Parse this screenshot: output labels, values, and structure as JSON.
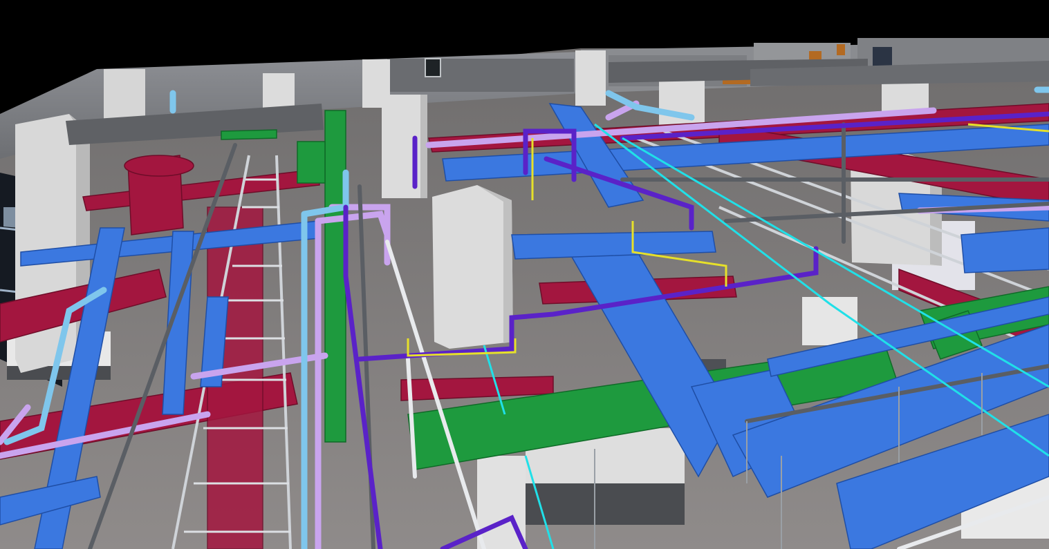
{
  "viewport": {
    "background": "#000000",
    "view_type": "3d-perspective-bim-model"
  },
  "scene": {
    "systems": [
      {
        "name": "supply-air-duct",
        "color": "#3b78e0"
      },
      {
        "name": "return-air-duct",
        "color": "#a3163f"
      },
      {
        "name": "exhaust-air-duct",
        "color": "#1e9a3e"
      },
      {
        "name": "violet-pipe",
        "color": "#5a22c8"
      },
      {
        "name": "lavender-pipe",
        "color": "#c9a4ee"
      },
      {
        "name": "light-blue-pipe",
        "color": "#7fc6ec"
      },
      {
        "name": "cyan-line",
        "color": "#20e0e8"
      },
      {
        "name": "yellow-line",
        "color": "#e6e02a"
      },
      {
        "name": "grey-pipe",
        "color": "#5a5e64"
      },
      {
        "name": "cable-tray",
        "color": "#cfd3d8"
      }
    ],
    "architecture": {
      "column_color": "#dcdcdc",
      "wall_color": "#8c8e92",
      "floor_color": "#8a8786",
      "window_color": "#9fb3c8",
      "door_color": "#b36a22"
    }
  }
}
